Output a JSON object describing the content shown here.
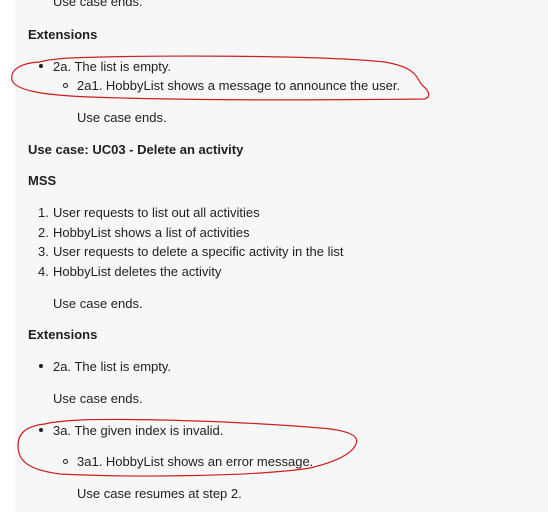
{
  "top": {
    "cut_text": "Use case ends."
  },
  "ext1": {
    "heading": "Extensions",
    "item": "2a. The list is empty.",
    "subitem": "2a1. HobbyList shows a message to announce the user.",
    "end": "Use case ends."
  },
  "uc03": {
    "title": "Use case: UC03 - Delete an activity",
    "mss_heading": "MSS",
    "steps": [
      "User requests to list out all activities",
      "HobbyList shows a list of activities",
      "User requests to delete a specific activity in the list",
      "HobbyList deletes the activity"
    ],
    "step_numbers": [
      "1.",
      "2.",
      "3.",
      "4."
    ],
    "end": "Use case ends."
  },
  "ext2": {
    "heading": "Extensions",
    "item1": "2a. The list is empty.",
    "item1_end": "Use case ends.",
    "item2": "3a. The given index is invalid.",
    "subitem2": "3a1. HobbyList shows an error message.",
    "resume": "Use case resumes at step 2."
  },
  "annotation": {
    "color": "#cc1f1f"
  }
}
